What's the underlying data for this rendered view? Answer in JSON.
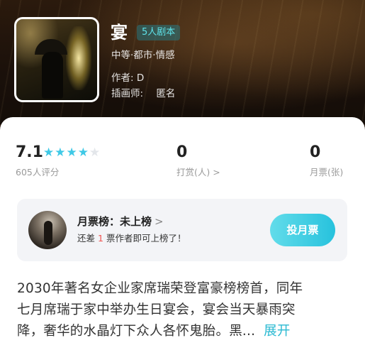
{
  "book": {
    "title": "宴",
    "tag": "5人剧本",
    "genre": "中等·都市·情感",
    "author_label": "作者:",
    "author": "D",
    "illustrator_label": "插画师:",
    "illustrator": "匿名"
  },
  "stats": {
    "rating": "7.1",
    "rating_stars": 4,
    "rating_stars_max": 5,
    "rating_count_label": "605人评分",
    "reward_value": "0",
    "reward_label": "打赏(人) >",
    "monthly_value": "0",
    "monthly_label": "月票(张)"
  },
  "rank": {
    "title": "月票榜：未上榜",
    "chevron": ">",
    "sub_prefix": "还差",
    "sub_number": "1",
    "sub_suffix": "票作者即可上榜了！",
    "vote_button": "投月票"
  },
  "description": {
    "lines": [
      "2030年著名女企业家席瑞荣登富豪榜榜首，同年",
      "七月席瑞于家中举办生日宴会，宴会当天暴雨突",
      "降，奢华的水晶灯下众人各怀鬼胎。黑..."
    ],
    "expand": "展开"
  },
  "colors": {
    "accent": "#27c2dd",
    "star": "#3fc9e6",
    "highlight_number": "#ef5350"
  }
}
